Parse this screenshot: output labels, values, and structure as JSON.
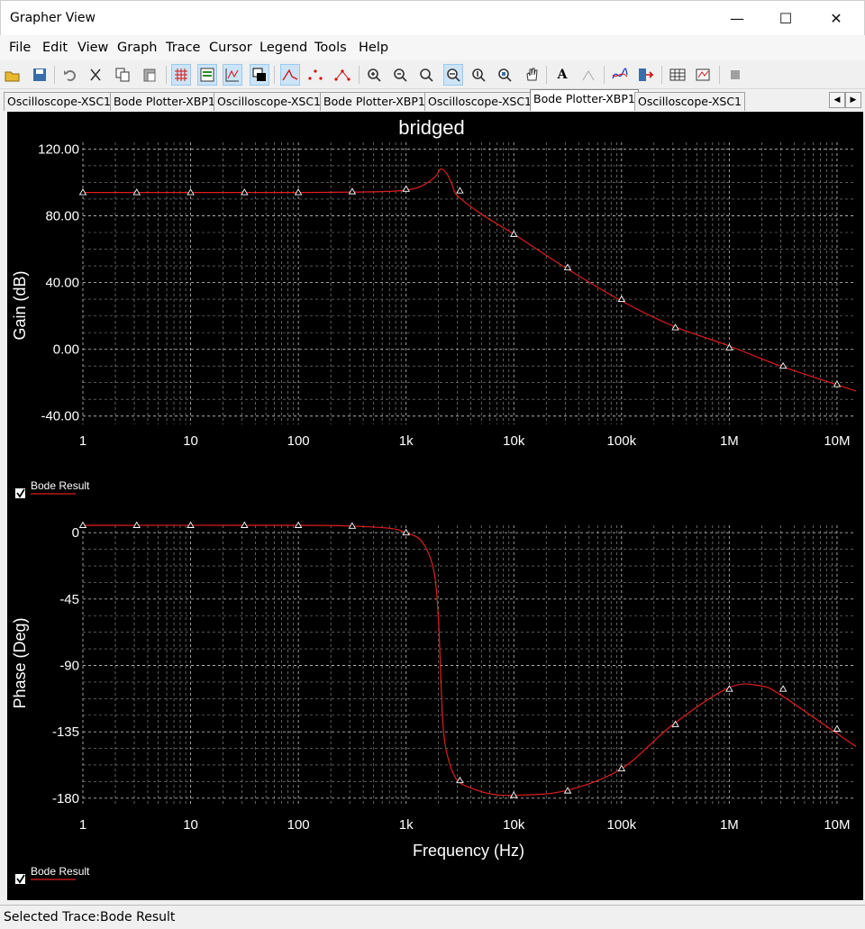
{
  "window": {
    "title": "Grapher View",
    "minimize": "—",
    "maximize": "☐",
    "close": "✕"
  },
  "menu": [
    "File",
    "Edit",
    "View",
    "Graph",
    "Trace",
    "Cursor",
    "Legend",
    "Tools",
    "Help"
  ],
  "toolbar_icons": [
    "open-icon",
    "save-icon",
    "undo-icon",
    "cut-icon",
    "copy-icon",
    "paste-icon",
    "grid-icon",
    "legend-icon",
    "graph-icon",
    "overlay-icon",
    "trace-line-icon",
    "trace-dots-icon",
    "trace-dotted-line-icon",
    "zoom-in-icon",
    "zoom-out-icon",
    "zoom-fit-icon",
    "zoom-x-icon",
    "zoom-y-icon",
    "zoom-area-icon",
    "pan-icon",
    "text-icon",
    "label-icon",
    "curve-icon",
    "export-icon",
    "table-icon",
    "graph-export-icon",
    "stop-icon"
  ],
  "tabs": [
    {
      "label": "Oscilloscope-XSC1",
      "active": false
    },
    {
      "label": "Bode Plotter-XBP1",
      "active": false
    },
    {
      "label": "Oscilloscope-XSC1",
      "active": false
    },
    {
      "label": "Bode Plotter-XBP1",
      "active": false
    },
    {
      "label": "Oscilloscope-XSC1",
      "active": false
    },
    {
      "label": "Bode Plotter-XBP1",
      "active": true
    },
    {
      "label": "Oscilloscope-XSC1",
      "active": false
    }
  ],
  "tab_scroll": {
    "left": "◀",
    "right": "▶"
  },
  "status": {
    "text": "Selected Trace:Bode Result"
  },
  "colors": {
    "plot_bg": "#000000",
    "trace": "#e11d1d",
    "grid": "#8a8a8a",
    "text": "#ffffff",
    "marker": "#ffffff"
  },
  "chart_data": [
    {
      "type": "line",
      "title": "bridged",
      "xlabel": "",
      "ylabel": "Gain (dB)",
      "xscale": "log",
      "xlim": [
        1,
        15000000
      ],
      "ylim": [
        -45,
        124
      ],
      "yticks": [
        120,
        80,
        40,
        0,
        -40
      ],
      "ytick_labels": [
        "120.00",
        "80.00",
        "40.00",
        "0.00",
        "-40.00"
      ],
      "xticks": [
        1,
        10,
        100,
        1000,
        10000,
        100000,
        1000000,
        10000000
      ],
      "xtick_labels": [
        "1",
        "10",
        "100",
        "1k",
        "10k",
        "100k",
        "1M",
        "10M"
      ],
      "grid": true,
      "legend": {
        "position": "bottom-left",
        "checked": true
      },
      "series": [
        {
          "name": "Bode Result",
          "x": [
            1,
            100,
            600,
            1000,
            1300,
            1600,
            1900,
            2100,
            2400,
            2700,
            3000,
            5000,
            10000,
            30000,
            100000,
            300000,
            1000000,
            3000000,
            15000000
          ],
          "y": [
            94,
            94,
            94.5,
            95.5,
            97,
            100,
            104,
            108,
            105,
            98,
            92,
            81,
            69,
            49,
            29,
            14,
            2,
            -10,
            -25
          ],
          "markers_x": [
            1,
            3.16,
            10,
            31.6,
            100,
            316,
            1000,
            3160,
            10000,
            31600,
            100000,
            316000,
            1000000,
            3160000,
            10000000
          ],
          "markers_y": [
            94,
            94,
            94,
            94,
            94,
            94.5,
            96,
            95,
            69,
            49,
            30,
            13,
            1,
            -10,
            -21
          ]
        }
      ]
    },
    {
      "type": "line",
      "title": "",
      "xlabel": "Frequency (Hz)",
      "ylabel": "Phase (Deg)",
      "xscale": "log",
      "xlim": [
        1,
        15000000
      ],
      "ylim": [
        -185,
        5
      ],
      "yticks": [
        0,
        -45,
        -90,
        -135,
        -180
      ],
      "ytick_labels": [
        "0",
        "-45",
        "-90",
        "-135",
        "-180"
      ],
      "xticks": [
        1,
        10,
        100,
        1000,
        10000,
        100000,
        1000000,
        10000000
      ],
      "xtick_labels": [
        "1",
        "10",
        "100",
        "1k",
        "10k",
        "100k",
        "1M",
        "10M"
      ],
      "grid": true,
      "legend": {
        "position": "bottom-left",
        "checked": true
      },
      "series": [
        {
          "name": "Bode Result",
          "x": [
            1,
            100,
            300,
            700,
            1000,
            1400,
            1800,
            2000,
            2200,
            2500,
            3000,
            4000,
            6000,
            10000,
            30000,
            100000,
            300000,
            1000000,
            2000000,
            3000000,
            6000000,
            15000000
          ],
          "y": [
            5,
            5,
            4.5,
            3,
            0,
            -6,
            -25,
            -60,
            -130,
            -155,
            -168,
            -173,
            -177,
            -178,
            -175,
            -160,
            -130,
            -105,
            -104,
            -110,
            -125,
            -145
          ],
          "markers_x": [
            1,
            3.16,
            10,
            31.6,
            100,
            316,
            1000,
            3160,
            10000,
            31600,
            100000,
            316000,
            1000000,
            3160000,
            10000000
          ],
          "markers_y": [
            5,
            5,
            5,
            5,
            5,
            4.5,
            0,
            -168,
            -178,
            -175,
            -160,
            -130,
            -106,
            -106,
            -133
          ]
        }
      ]
    }
  ]
}
